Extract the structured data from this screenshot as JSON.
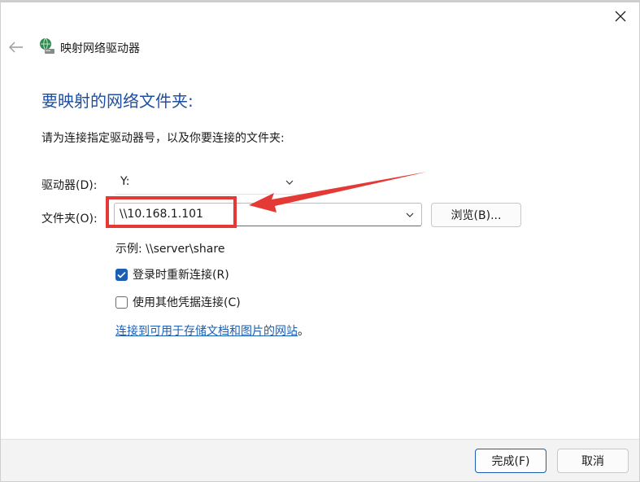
{
  "window": {
    "title": "映射网络驱动器",
    "close_icon": "close-icon",
    "back_icon": "back-arrow-icon",
    "app_icon": "network-drive-icon"
  },
  "content": {
    "heading": "要映射的网络文件夹:",
    "instruction": "请为连接指定驱动器号，以及你要连接的文件夹:",
    "drive_label": "驱动器(D):",
    "drive_value": "Y:",
    "folder_label": "文件夹(O):",
    "folder_value": "\\\\10.168.1.101",
    "browse_label": "浏览(B)...",
    "example": "示例: \\\\server\\share",
    "reconnect_label": "登录时重新连接(R)",
    "reconnect_checked": true,
    "credentials_label": "使用其他凭据连接(C)",
    "credentials_checked": false,
    "link_text": "连接到可用于存储文档和图片的网站",
    "link_suffix": "。"
  },
  "footer": {
    "finish_label": "完成(F)",
    "cancel_label": "取消"
  },
  "colors": {
    "heading": "#1f4fa0",
    "accent": "#1a5fb4",
    "annotation": "#e53935"
  }
}
